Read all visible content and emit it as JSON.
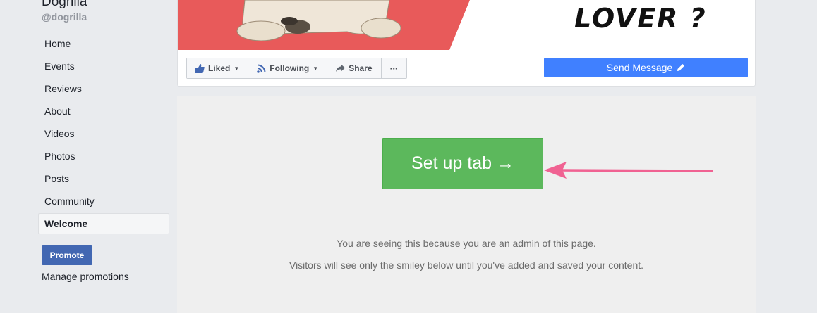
{
  "sidebar": {
    "page_name": "Dogrilla",
    "page_handle": "@dogrilla",
    "nav_items": [
      {
        "label": "Home"
      },
      {
        "label": "Events"
      },
      {
        "label": "Reviews"
      },
      {
        "label": "About"
      },
      {
        "label": "Videos"
      },
      {
        "label": "Photos"
      },
      {
        "label": "Posts"
      },
      {
        "label": "Community"
      },
      {
        "label": "Welcome",
        "active": true
      }
    ],
    "promote_label": "Promote",
    "manage_promotions_label": "Manage promotions"
  },
  "cover": {
    "text": "LOVER ?",
    "accent_color": "#e85a5a"
  },
  "actions": {
    "liked_label": "Liked",
    "following_label": "Following",
    "share_label": "Share",
    "more_label": "···",
    "send_message_label": "Send Message"
  },
  "tab": {
    "setup_label": "Set up tab →",
    "setup_color": "#5cb85c",
    "admin_message": "You are seeing this because you are an admin of this page.",
    "visitor_message": "Visitors will see only the smiley below until you've added and saved your content.",
    "arrow_color": "#f06292"
  }
}
